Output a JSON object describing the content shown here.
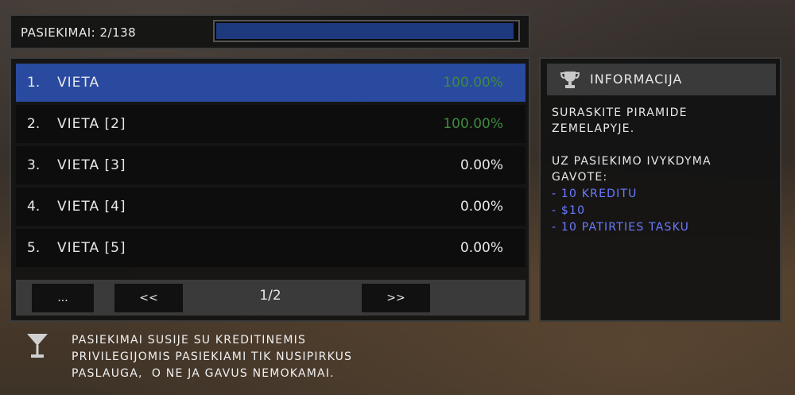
{
  "progress": {
    "label": "PASIEKIMAI: 2/138",
    "fraction": 0.99
  },
  "list": {
    "rows": [
      {
        "num": "1.",
        "name": "VIETA",
        "pct": "100.00%",
        "done": true,
        "selected": true
      },
      {
        "num": "2.",
        "name": "VIETA [2]",
        "pct": "100.00%",
        "done": true,
        "selected": false
      },
      {
        "num": "3.",
        "name": "VIETA [3]",
        "pct": "0.00%",
        "done": false,
        "selected": false
      },
      {
        "num": "4.",
        "name": "VIETA [4]",
        "pct": "0.00%",
        "done": false,
        "selected": false
      },
      {
        "num": "5.",
        "name": "VIETA [5]",
        "pct": "0.00%",
        "done": false,
        "selected": false
      }
    ]
  },
  "pager": {
    "more_label": "...",
    "prev_label": "<<",
    "page": "1/2",
    "next_label": ">>"
  },
  "info": {
    "title": "INFORMACIJA",
    "icon": "trophy-icon",
    "description": [
      "SURASKITE PIRAMIDE",
      "ZEMELAPYJE."
    ],
    "reward_heading": [
      "UZ PASIEKIMO IVYKDYMA",
      "GAVOTE:"
    ],
    "rewards": [
      "- 10 KREDITU",
      "- $10",
      "- 10 PATIRTIES TASKU"
    ]
  },
  "footer": {
    "icon": "cocktail-glass-icon",
    "lines": [
      "PASIEKIMAI SUSIJE SU KREDITINEMIS",
      "PRIVILEGIJOMIS PASIEKIAMI TIK NUSIPIRKUS",
      "PASLAUGA,  O NE JA GAVUS NEMOKAMAI."
    ]
  },
  "colors": {
    "selected_row": "#2a4aa0",
    "done_pct": "#3f8a3f",
    "reward_text": "#6b7cff",
    "progress_fill": "#1e3a7e"
  }
}
